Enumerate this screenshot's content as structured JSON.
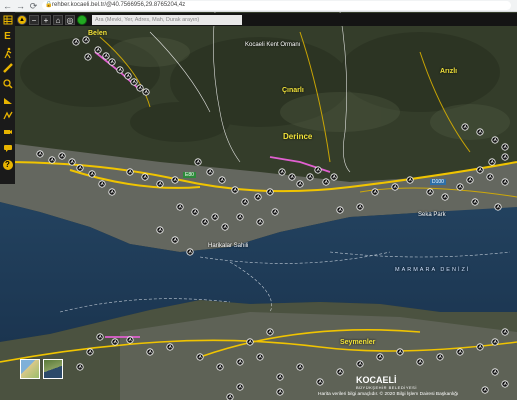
{
  "browser": {
    "back": "←",
    "forward": "→",
    "reload": "⟳",
    "url": "rehber.kocaeli.bel.tr/@40.7566956,29.8765204,4z"
  },
  "toolbar": {
    "search_placeholder": "Ara (Mevki, Yer, Adres, Mah, Durak arayın)",
    "zoom_in": "+",
    "zoom_out": "−",
    "home": "⌂",
    "locate": "◎"
  },
  "sidebar": {
    "items": [
      {
        "icon": "layers-icon"
      },
      {
        "icon": "e-letter-icon",
        "label": "E"
      },
      {
        "icon": "walk-icon"
      },
      {
        "icon": "ruler-icon"
      },
      {
        "icon": "search-icon"
      },
      {
        "icon": "measure-icon"
      },
      {
        "icon": "route-icon"
      },
      {
        "icon": "camera-icon"
      },
      {
        "icon": "chat-icon"
      },
      {
        "icon": "help-icon",
        "label": "?"
      }
    ]
  },
  "map_labels": {
    "belen": "Belen",
    "kocaeli_kent_ormani": "Kocaeli Kent Ormanı",
    "cinarli": "Çınarlı",
    "derince": "Derince",
    "arizli": "Arızlı",
    "harikalar_sahili": "Harikalar Sahili",
    "seka_park": "Seka Park",
    "marmara_denizi": "MARMARA DENİZİ",
    "seymenler": "Seymenler"
  },
  "road_signs": {
    "e80": "E80",
    "d100": "D100"
  },
  "footer": {
    "credit": "Harita verileri bilgi amaçlıdır. © 2020 Bilgi İşlem Dairesi Başkanlığı",
    "brand": "KOCAELİ",
    "brand_sub": "BÜYÜKŞEHİR BELEDİYESİ"
  },
  "colors": {
    "toolbar": "#141414",
    "accent_yellow": "#e8b400",
    "road_yellow": "#f0c400",
    "sea": "#1f3a5a",
    "land": "#3b4430"
  }
}
